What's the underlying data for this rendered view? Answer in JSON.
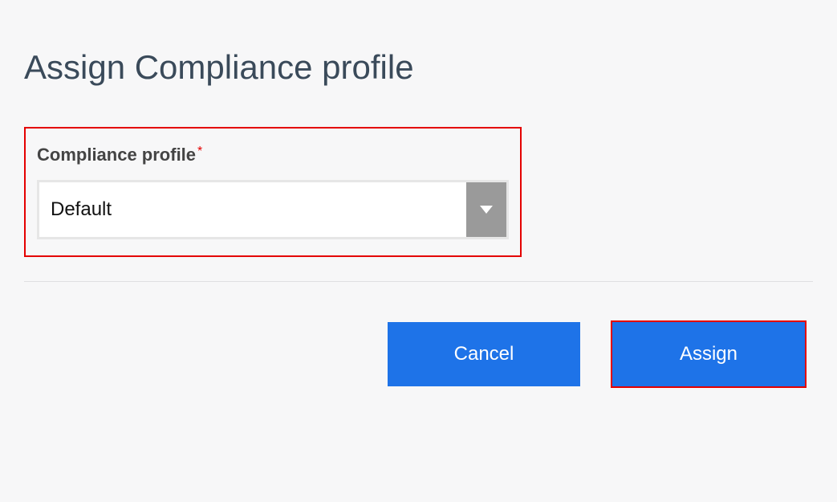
{
  "dialog": {
    "title": "Assign Compliance profile",
    "field": {
      "label": "Compliance profile",
      "required_mark": "*",
      "selected_value": "Default"
    },
    "actions": {
      "cancel": "Cancel",
      "assign": "Assign"
    }
  }
}
